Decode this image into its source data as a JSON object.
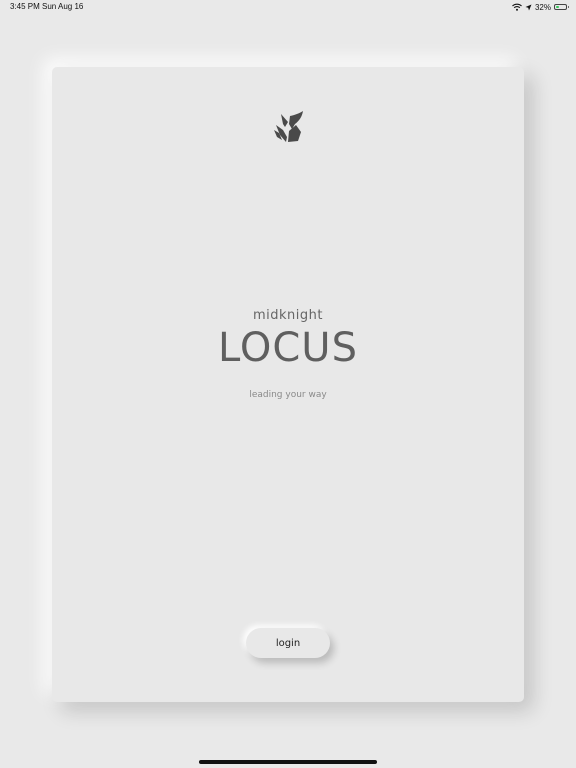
{
  "status_bar": {
    "time": "3:45 PM",
    "date": "Sun Aug 16",
    "battery_percent": "32%",
    "battery_level": 0.32,
    "icons": [
      "wifi-icon",
      "location-arrow-icon",
      "battery-icon"
    ]
  },
  "app": {
    "brand_small": "midknight",
    "brand_large": "LOCUS",
    "tagline": "leading your way",
    "logo": "knight-helmet-icon",
    "login_label": "login"
  },
  "colors": {
    "background": "#e9e9e9",
    "card": "#e8e8e8",
    "title_text": "#5f5f5f",
    "battery_fill": "#34c759"
  }
}
